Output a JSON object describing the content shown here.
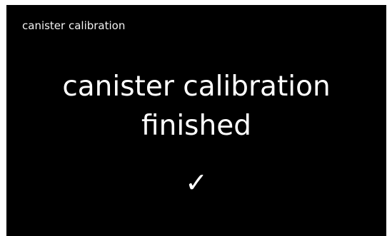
{
  "header": {
    "title": "canister calibration"
  },
  "message": {
    "line1": "canister calibration",
    "line2": "finished"
  },
  "status": {
    "icon": "check-icon",
    "glyph": "✓"
  },
  "colors": {
    "background": "#000000",
    "text": "#ffffff"
  }
}
